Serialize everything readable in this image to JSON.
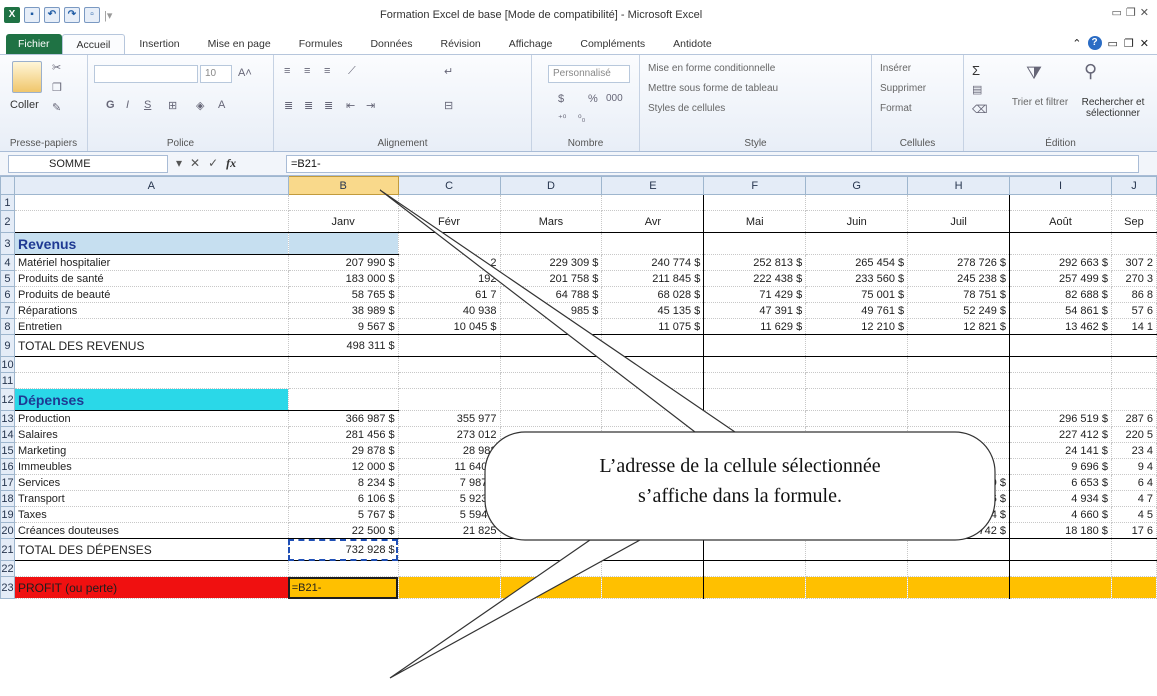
{
  "window": {
    "title": "Formation Excel de base  [Mode de compatibilité]  -  Microsoft Excel"
  },
  "tabs": [
    "Fichier",
    "Accueil",
    "Insertion",
    "Mise en page",
    "Formules",
    "Données",
    "Révision",
    "Affichage",
    "Compléments",
    "Antidote"
  ],
  "ribbon": {
    "clipboard": {
      "label": "Presse-papiers",
      "paste": "Coller"
    },
    "font": {
      "label": "Police",
      "size": "10",
      "bold": "G",
      "italic": "I",
      "underline": "S"
    },
    "alignment": {
      "label": "Alignement"
    },
    "number": {
      "label": "Nombre",
      "format": "Personnalisé",
      "percent": "%",
      "thousands": "000"
    },
    "style": {
      "label": "Style",
      "cond": "Mise en forme conditionnelle",
      "table": "Mettre sous forme de tableau",
      "cell": "Styles de cellules"
    },
    "cells": {
      "label": "Cellules",
      "insert": "Insérer",
      "delete": "Supprimer",
      "format": "Format"
    },
    "editing": {
      "label": "Édition",
      "sort": "Trier et filtrer",
      "find": "Rechercher et sélectionner"
    }
  },
  "formula_bar": {
    "name_box": "SOMME",
    "formula": "=B21-"
  },
  "sheet": {
    "columns": [
      "A",
      "B",
      "C",
      "D",
      "E",
      "F",
      "G",
      "H",
      "I",
      "J"
    ],
    "months": [
      "Janv",
      "Févr",
      "Mars",
      "Avr",
      "Mai",
      "Juin",
      "Juil",
      "Août",
      "Sep"
    ],
    "revenus_header": "Revenus",
    "revenus": [
      {
        "label": "Matériel hospitalier",
        "values": [
          "207 990 $",
          "2",
          "229 309 $",
          "240 774 $",
          "252 813 $",
          "265 454 $",
          "278 726 $",
          "292 663 $",
          "307 2"
        ]
      },
      {
        "label": "Produits de santé",
        "values": [
          "183 000 $",
          "192",
          "201 758 $",
          "211 845 $",
          "222 438 $",
          "233 560 $",
          "245 238 $",
          "257 499 $",
          "270 3"
        ]
      },
      {
        "label": "Produits de beauté",
        "values": [
          "58 765 $",
          "61 7",
          "64 788 $",
          "68 028 $",
          "71 429 $",
          "75 001 $",
          "78 751 $",
          "82 688 $",
          "86 8"
        ]
      },
      {
        "label": "Réparations",
        "values": [
          "38 989 $",
          "40 938",
          "985 $",
          "45 135 $",
          "47 391 $",
          "49 761 $",
          "52 249 $",
          "54 861 $",
          "57 6"
        ]
      },
      {
        "label": "Entretien",
        "values": [
          "9 567 $",
          "10 045 $",
          "",
          "11 075 $",
          "11 629 $",
          "12 210 $",
          "12 821 $",
          "13 462 $",
          "14 1"
        ]
      }
    ],
    "total_revenus": {
      "label": "TOTAL DES REVENUS",
      "value": "498 311 $"
    },
    "depenses_header": "Dépenses",
    "depenses": [
      {
        "label": "Production",
        "values": [
          "366 987 $",
          "355 977",
          "",
          "",
          "",
          "",
          "",
          "296 519 $",
          "287 6"
        ]
      },
      {
        "label": "Salaires",
        "values": [
          "281 456 $",
          "273 012",
          "",
          "",
          "",
          "",
          "",
          "227 412 $",
          "220 5"
        ]
      },
      {
        "label": "Marketing",
        "values": [
          "29 878 $",
          "28 982",
          "",
          "",
          "",
          "",
          "",
          "24 141 $",
          "23 4"
        ]
      },
      {
        "label": "Immeubles",
        "values": [
          "12 000 $",
          "11 640 $",
          "11",
          "",
          "",
          "",
          "",
          "9 696 $",
          "9 4"
        ]
      },
      {
        "label": "Services",
        "values": [
          "8 234 $",
          "7 987 $",
          "",
          "",
          "7 290 $",
          "7 071 $",
          "6 859 $",
          "6 653 $",
          "6 4"
        ]
      },
      {
        "label": "Transport",
        "values": [
          "6 106 $",
          "5 923 $",
          "",
          "5 673 $",
          "5 406 $",
          "5 243 $",
          "5 086 $",
          "4 934 $",
          "4 7"
        ]
      },
      {
        "label": "Taxes",
        "values": [
          "5 767 $",
          "5 594 $",
          "",
          "5 263 $",
          "5 105 $",
          "4 952 $",
          "4 804 $",
          "4 660 $",
          "4 5"
        ]
      },
      {
        "label": "Créances douteuses",
        "values": [
          "22 500 $",
          "21 825",
          "21 170 $",
          "20 535 $",
          "19 919 $",
          "19 322 $",
          "18 742 $",
          "18 180 $",
          "17 6"
        ]
      }
    ],
    "total_depenses": {
      "label": "TOTAL DES DÉPENSES",
      "value": "732 928 $"
    },
    "profit": {
      "label": "PROFIT (ou perte)",
      "value": "=B21-"
    }
  },
  "callout": {
    "line1": "L’adresse de la cellule sélectionnée",
    "line2": "s’affiche dans la formule."
  }
}
